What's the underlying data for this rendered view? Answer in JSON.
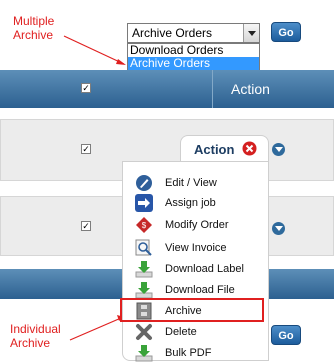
{
  "annotations": {
    "multiple_line1": "Multiple",
    "multiple_line2": "Archive",
    "individual_line1": "Individual",
    "individual_line2": "Archive"
  },
  "bulk_select": {
    "value": "Archive Orders",
    "options": [
      "Download Orders",
      "Archive Orders"
    ],
    "selected_index": 1
  },
  "go_label": "Go",
  "table": {
    "action_header": "Action",
    "header_checkbox": "✓"
  },
  "row_checkbox": "✓",
  "action_popup": {
    "title": "Action",
    "items": [
      {
        "label": "Edit / View",
        "icon": "edit-icon"
      },
      {
        "label": "Assign job",
        "icon": "assign-arrow-icon"
      },
      {
        "label": "Modify Order",
        "icon": "modify-order-icon"
      },
      {
        "label": "View Invoice",
        "icon": "magnifier-icon"
      },
      {
        "label": "Download Label",
        "icon": "download-icon"
      },
      {
        "label": "Download File",
        "icon": "download-icon"
      },
      {
        "label": "Archive",
        "icon": "archive-icon"
      },
      {
        "label": "Delete",
        "icon": "delete-icon"
      },
      {
        "label": "Bulk PDF",
        "icon": "download-icon"
      }
    ]
  },
  "colors": {
    "annotation": "#e02020",
    "header_bar": "#2c6090",
    "selection": "#3399ff"
  }
}
